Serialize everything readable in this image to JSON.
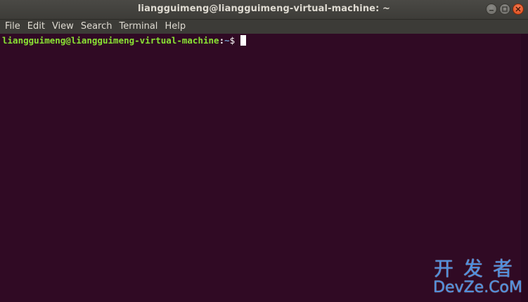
{
  "window": {
    "title": "liangguimeng@liangguimeng-virtual-machine: ~"
  },
  "menu": {
    "items": [
      "File",
      "Edit",
      "View",
      "Search",
      "Terminal",
      "Help"
    ]
  },
  "terminal": {
    "prompt_user_host": "liangguimeng@liangguimeng-virtual-machine",
    "prompt_sep": ":",
    "prompt_path": "~",
    "prompt_sign": "$"
  },
  "watermark": {
    "cn": "开发者",
    "en": "DevZe.CoM"
  },
  "colors": {
    "terminal_bg": "#300a24",
    "prompt_user": "#8ae234",
    "prompt_path": "#729fcf",
    "close_button": "#df4a16"
  },
  "icons": [
    "minimize-icon",
    "maximize-icon",
    "close-icon"
  ]
}
